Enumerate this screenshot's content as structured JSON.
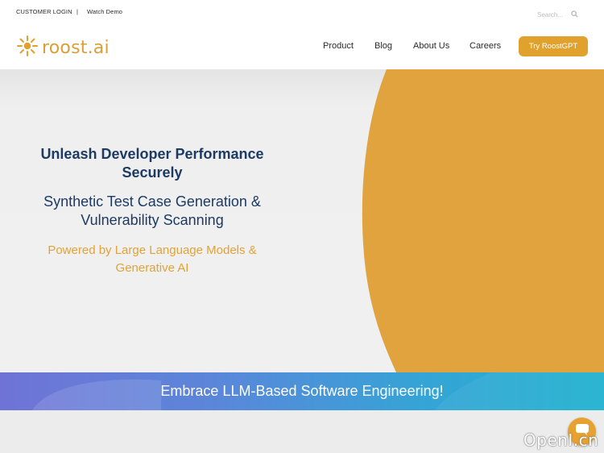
{
  "topbar": {
    "customer_login": "CUSTOMER LOGIN",
    "separator": "|",
    "watch_demo": "Watch Demo",
    "search_placeholder": "Search..."
  },
  "brand": {
    "logo_text": "roost.ai",
    "logo_icon": "sun-icon",
    "accent_color": "#e0a12d",
    "navy_color": "#1d3a63"
  },
  "nav": {
    "items": [
      "Product",
      "Blog",
      "About Us",
      "Careers"
    ],
    "cta_label": "Try RoostGPT"
  },
  "hero": {
    "headline": "Unleash Developer Performance Securely",
    "subheadline": "Synthetic Test Case Generation & Vulnerability Scanning",
    "tagline": "Powered by Large Language Models & Generative AI"
  },
  "banner": {
    "text": "Embrace LLM-Based Software Engineering!"
  },
  "chat": {
    "icon": "chat-bubble-icon"
  },
  "watermark": {
    "text": "OpenI.cn"
  }
}
